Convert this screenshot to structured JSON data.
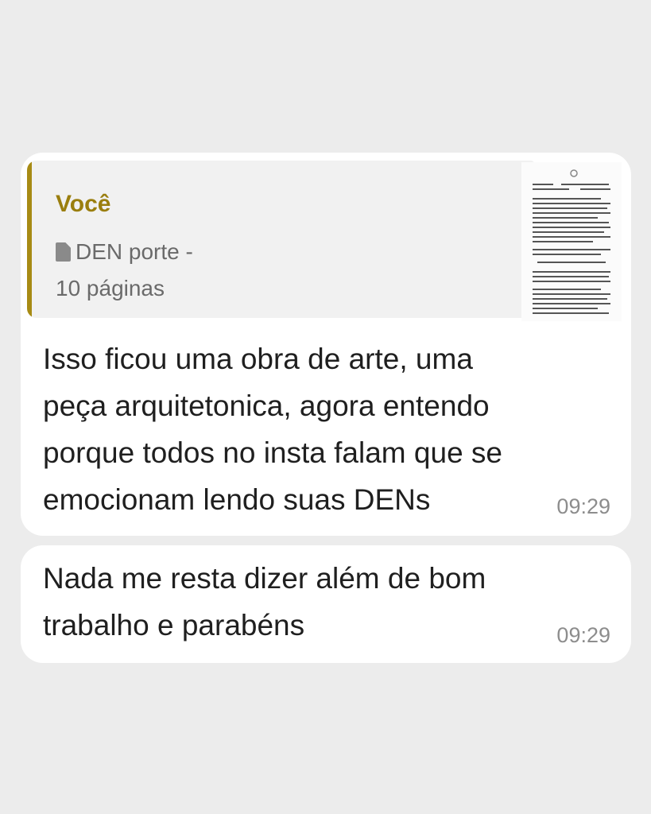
{
  "messages": [
    {
      "quote": {
        "author": "Você",
        "file_name": "DEN porte -",
        "file_pages": "10 páginas",
        "icon": "document-icon"
      },
      "lines": [
        "Isso ficou uma obra de arte, uma",
        "peça arquitetonica, agora entendo",
        "porque todos no insta falam que se",
        "emocionam lendo suas DENs"
      ],
      "time": "09:29"
    },
    {
      "lines": [
        "Nada me resta dizer além de bom",
        "trabalho e parabéns"
      ],
      "time": "09:29"
    }
  ],
  "colors": {
    "background": "#ececec",
    "bubble": "#ffffff",
    "quote_accent": "#a78b14",
    "quote_author": "#9a7e0e"
  }
}
